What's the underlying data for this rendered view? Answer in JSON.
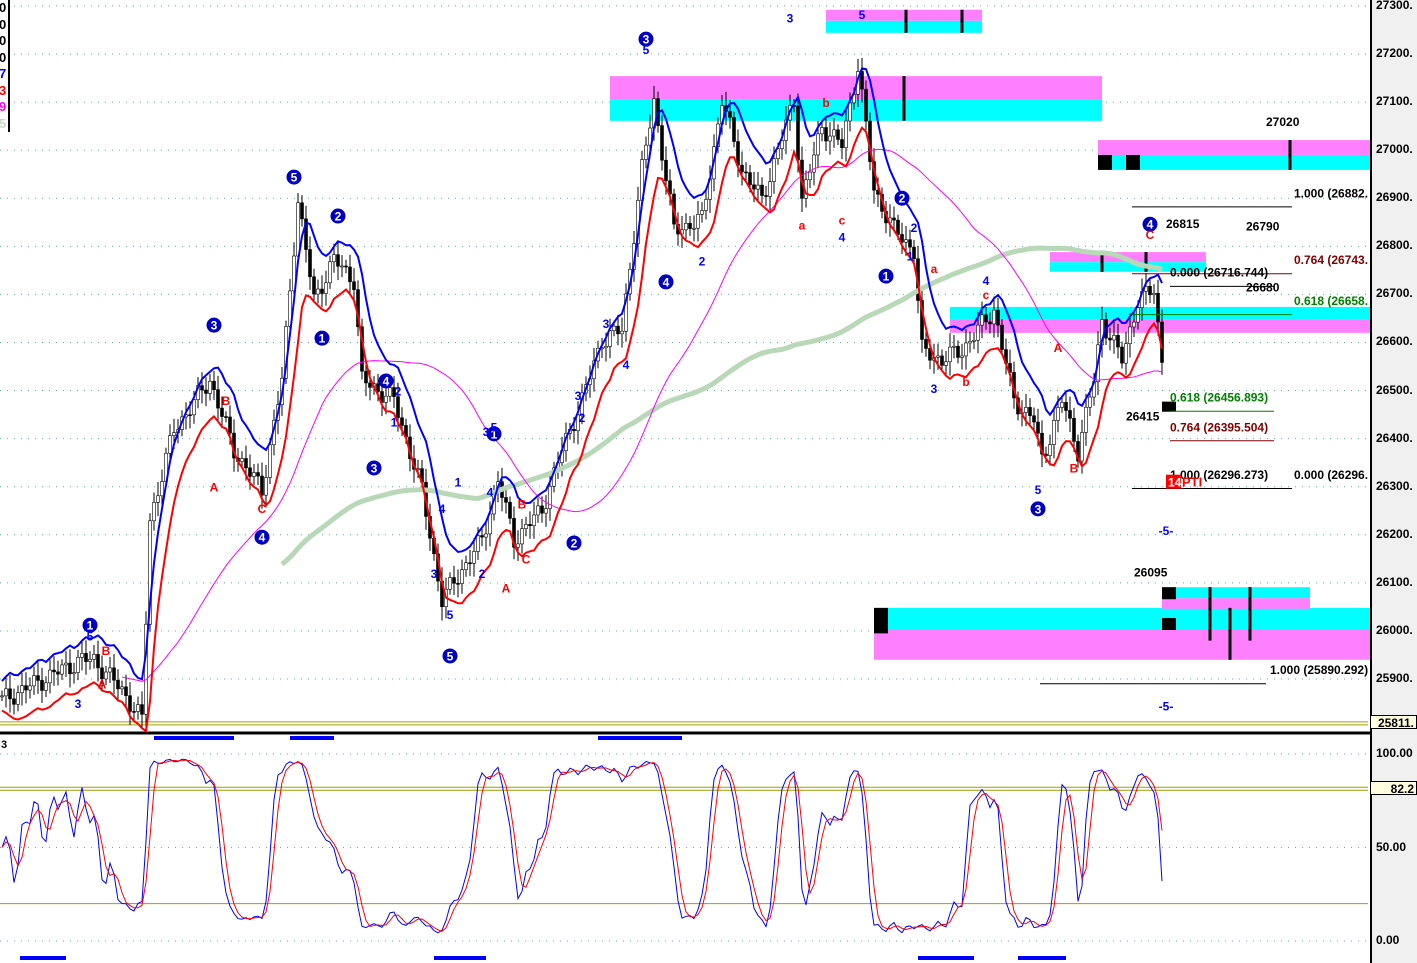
{
  "legend": [
    {
      "t": "0",
      "c": "#000000"
    },
    {
      "t": "0",
      "c": "#000000"
    },
    {
      "t": "0",
      "c": "#000000"
    },
    {
      "t": "0",
      "c": "#000000"
    },
    {
      "t": "7",
      "c": "#0000ff"
    },
    {
      "t": "3",
      "c": "#ff0000"
    },
    {
      "t": "9",
      "c": "#ff00ff"
    },
    {
      "t": "5",
      "c": "#c8dcc8"
    }
  ],
  "stoch_panel_label": "3",
  "chart_data": {
    "type": "candlestick",
    "price_axis": {
      "ticks": [
        "25900.",
        "26000.",
        "26100.",
        "26200.",
        "26300.",
        "26400.",
        "26500.",
        "26600.",
        "26700.",
        "26800.",
        "26900.",
        "27000.",
        "27100.",
        "27200.",
        "27300."
      ],
      "range": [
        25800,
        27310
      ],
      "current": "25811.",
      "current_value": 25811
    },
    "stoch_axis": {
      "ticks": [
        "100.00",
        "50.00",
        "0.00"
      ],
      "current": "82.2",
      "current_value": 82.2,
      "levels": [
        82.2,
        20
      ]
    },
    "close_path": [
      [
        0,
        25856
      ],
      [
        20,
        25940
      ],
      [
        23,
        25940
      ],
      [
        30,
        25877
      ],
      [
        35,
        25815
      ],
      [
        37,
        26231
      ],
      [
        43,
        26418
      ],
      [
        52,
        26522
      ],
      [
        58,
        26376
      ],
      [
        65,
        26293
      ],
      [
        70,
        26522
      ],
      [
        74,
        26896
      ],
      [
        78,
        26688
      ],
      [
        83,
        26772
      ],
      [
        88,
        26730
      ],
      [
        90,
        26522
      ],
      [
        98,
        26480
      ],
      [
        105,
        26293
      ],
      [
        110,
        26064
      ],
      [
        115,
        26127
      ],
      [
        120,
        26189
      ],
      [
        124,
        26314
      ],
      [
        128,
        26189
      ],
      [
        135,
        26252
      ],
      [
        140,
        26376
      ],
      [
        145,
        26480
      ],
      [
        150,
        26605
      ],
      [
        155,
        26626
      ],
      [
        160,
        26959
      ],
      [
        163,
        27104
      ],
      [
        168,
        26834
      ],
      [
        175,
        26855
      ],
      [
        180,
        27104
      ],
      [
        185,
        26959
      ],
      [
        190,
        26896
      ],
      [
        198,
        27104
      ],
      [
        200,
        26896
      ],
      [
        205,
        27050
      ],
      [
        210,
        27010
      ],
      [
        214,
        27177
      ],
      [
        218,
        26917
      ],
      [
        223,
        26834
      ],
      [
        228,
        26792
      ],
      [
        230,
        26584
      ],
      [
        235,
        26564
      ],
      [
        240,
        26584
      ],
      [
        248,
        26668
      ],
      [
        253,
        26480
      ],
      [
        258,
        26439
      ],
      [
        260,
        26356
      ],
      [
        265,
        26480
      ],
      [
        269,
        26376
      ],
      [
        273,
        26522
      ],
      [
        275,
        26647
      ],
      [
        280,
        26564
      ],
      [
        284,
        26688
      ],
      [
        288,
        26709
      ],
      [
        290,
        26564
      ]
    ],
    "colors": {
      "ema_high": "#0000ff",
      "ema_low": "#ff0000",
      "sma_mid": "#ff00ff",
      "sma_long": "#b8d8b8",
      "stoch_k": "#0000ff",
      "stoch_d": "#ff0000",
      "zone_top": "#ff80ff",
      "zone_cyan": "#00ffff"
    },
    "zones": [
      {
        "b0": 206,
        "b1": 245,
        "p": [
          27292,
          27269,
          27244
        ]
      },
      {
        "b0": 152,
        "b1": 275,
        "p": [
          27154,
          27106,
          27061
        ]
      },
      {
        "b0": 274,
        "b1": 342,
        "p": [
          27021,
          26990,
          26959
        ]
      },
      {
        "b0": 262,
        "b1": 301,
        "p": [
          26788,
          26767,
          26747
        ]
      },
      {
        "b0": 237,
        "b1": 342,
        "p": [
          26620,
          26647,
          26674
        ],
        "cyan_top": true
      },
      {
        "b0": 218,
        "b1": 342,
        "p": [
          25940,
          26002,
          26048
        ],
        "cyan_top": true
      },
      {
        "b0": 290,
        "b1": 327,
        "p": [
          26046,
          26068,
          26091
        ],
        "cyan_top": true
      }
    ],
    "blocks": [
      {
        "b0": 274,
        "b1": 277.5,
        "p0": 26990,
        "p1": 26959
      },
      {
        "b0": 281,
        "b1": 284.5,
        "p0": 26990,
        "p1": 26959
      },
      {
        "b0": 218,
        "b1": 221.5,
        "p0": 26048,
        "p1": 25995
      },
      {
        "b0": 290,
        "b1": 293.5,
        "p0": 26091,
        "p1": 26066
      },
      {
        "b0": 290,
        "b1": 293.5,
        "p0": 26027,
        "p1": 26002
      },
      {
        "b0": 290,
        "b1": 293.5,
        "p0": 26477,
        "p1": 26456
      }
    ],
    "ticks_v": [
      {
        "b": 226,
        "p0": 27292,
        "p1": 27244
      },
      {
        "b": 240,
        "p0": 27292,
        "p1": 27244
      },
      {
        "b": 225.5,
        "p0": 27154,
        "p1": 27061
      },
      {
        "b": 322,
        "p0": 27021,
        "p1": 26959
      },
      {
        "b": 275,
        "p0": 26788,
        "p1": 26747
      },
      {
        "b": 286,
        "p0": 26788,
        "p1": 26747
      },
      {
        "b": 302,
        "p0": 26091,
        "p1": 25980
      },
      {
        "b": 312,
        "p0": 26091,
        "p1": 25980
      },
      {
        "b": 307,
        "p0": 26048,
        "p1": 25940
      }
    ],
    "waves": [
      {
        "t": "1",
        "b": 22,
        "p": 26012,
        "circ": true
      },
      {
        "t": "3",
        "b": 53,
        "p": 26636,
        "circ": true
      },
      {
        "t": "5",
        "b": 73,
        "p": 26944,
        "circ": true
      },
      {
        "t": "2",
        "b": 84,
        "p": 26863,
        "circ": true
      },
      {
        "t": "1",
        "b": 80,
        "p": 26609,
        "circ": true
      },
      {
        "t": "4",
        "b": 96,
        "p": 26520,
        "circ": true
      },
      {
        "t": "3",
        "b": 93,
        "p": 26339,
        "circ": true
      },
      {
        "t": "4",
        "b": 65,
        "p": 26195,
        "circ": true
      },
      {
        "t": "5",
        "b": 112,
        "p": 25948,
        "circ": true
      },
      {
        "t": "1",
        "b": 123,
        "p": 26410,
        "circ": true
      },
      {
        "t": "2",
        "b": 143,
        "p": 26183,
        "circ": true
      },
      {
        "t": "3",
        "b": 161,
        "p": 27231,
        "circ": true
      },
      {
        "t": "4",
        "b": 166,
        "p": 26726,
        "circ": true
      },
      {
        "t": "1",
        "b": 221,
        "p": 26738,
        "circ": true
      },
      {
        "t": "2",
        "b": 225,
        "p": 26900,
        "circ": true
      },
      {
        "t": "3",
        "b": 259,
        "p": 26254,
        "circ": true
      },
      {
        "t": "4",
        "b": 287,
        "p": 26846,
        "circ": true
      },
      {
        "t": "5",
        "b": 22,
        "p": 25980,
        "c": "#0000ff"
      },
      {
        "t": "3",
        "b": 19,
        "p": 25840,
        "c": "#0000ff"
      },
      {
        "t": "5",
        "b": 161,
        "p": 27200,
        "c": "#0000ff"
      },
      {
        "t": "3",
        "b": 197,
        "p": 27265,
        "c": "#0000ff"
      },
      {
        "t": "5",
        "b": 215,
        "p": 27273,
        "c": "#0000ff"
      },
      {
        "t": "2",
        "b": 175,
        "p": 26760,
        "c": "#0000ff"
      },
      {
        "t": "3",
        "b": 151,
        "p": 26630,
        "c": "#0000ff"
      },
      {
        "t": "4",
        "b": 156,
        "p": 26545,
        "c": "#0000ff"
      },
      {
        "t": "1",
        "b": 114,
        "p": 26300,
        "c": "#0000ff"
      },
      {
        "t": "4",
        "b": 110,
        "p": 26245,
        "c": "#0000ff"
      },
      {
        "t": "3",
        "b": 108,
        "p": 26110,
        "c": "#0000ff"
      },
      {
        "t": "5",
        "b": 112,
        "p": 26025,
        "c": "#0000ff"
      },
      {
        "t": "2",
        "b": 120,
        "p": 26110,
        "c": "#0000ff"
      },
      {
        "t": "3",
        "b": 121,
        "p": 26405,
        "c": "#0000ff"
      },
      {
        "t": "5",
        "b": 123,
        "p": 26415,
        "c": "#0000ff"
      },
      {
        "t": "4",
        "b": 122,
        "p": 26280,
        "c": "#0000ff"
      },
      {
        "t": "1",
        "b": 98,
        "p": 26425,
        "c": "#0000ff"
      },
      {
        "t": "2",
        "b": 99,
        "p": 26490,
        "c": "#0000ff"
      },
      {
        "t": "2",
        "b": 145,
        "p": 26435,
        "c": "#0000ff"
      },
      {
        "t": "3",
        "b": 144,
        "p": 26480,
        "c": "#0000ff"
      },
      {
        "t": "4",
        "b": 210,
        "p": 26810,
        "c": "#0000ff"
      },
      {
        "t": "2",
        "b": 228,
        "p": 26830,
        "c": "#0000ff"
      },
      {
        "t": "1",
        "b": 227,
        "p": 26770,
        "c": "#0000ff"
      },
      {
        "t": "3",
        "b": 233,
        "p": 26495,
        "c": "#0000ff"
      },
      {
        "t": "4",
        "b": 246,
        "p": 26720,
        "c": "#0000ff"
      },
      {
        "t": "5",
        "b": 259,
        "p": 26285,
        "c": "#0000ff"
      },
      {
        "t": "-5-",
        "b": 291,
        "p": 26200,
        "c": "#0000ff"
      },
      {
        "t": "-5-",
        "b": 291,
        "p": 25835,
        "c": "#0000ff"
      },
      {
        "t": "A",
        "b": 53,
        "p": 26290,
        "c": "#ff0000"
      },
      {
        "t": "B",
        "b": 56,
        "p": 26470,
        "c": "#ff0000"
      },
      {
        "t": "C",
        "b": 65,
        "p": 26245,
        "c": "#ff0000"
      },
      {
        "t": "B",
        "b": 26,
        "p": 25950,
        "c": "#ff0000"
      },
      {
        "t": "A",
        "b": 25,
        "p": 25880,
        "c": "#ff0000"
      },
      {
        "t": "A",
        "b": 126,
        "p": 26080,
        "c": "#ff0000"
      },
      {
        "t": "B",
        "b": 130,
        "p": 26255,
        "c": "#ff0000"
      },
      {
        "t": "C",
        "b": 131,
        "p": 26140,
        "c": "#ff0000"
      },
      {
        "t": "a",
        "b": 200,
        "p": 26835,
        "c": "#ff0000"
      },
      {
        "t": "b",
        "b": 206,
        "p": 27090,
        "c": "#ff0000"
      },
      {
        "t": "c",
        "b": 210,
        "p": 26845,
        "c": "#ff0000"
      },
      {
        "t": "a",
        "b": 233,
        "p": 26745,
        "c": "#ff0000"
      },
      {
        "t": "b",
        "b": 241,
        "p": 26510,
        "c": "#ff0000"
      },
      {
        "t": "c",
        "b": 246,
        "p": 26690,
        "c": "#ff0000"
      },
      {
        "t": "A",
        "b": 264,
        "p": 26580,
        "c": "#ff0000"
      },
      {
        "t": "B",
        "b": 268,
        "p": 26330,
        "c": "#ff0000"
      },
      {
        "t": "C",
        "b": 287,
        "p": 26815,
        "c": "#ff0000"
      }
    ],
    "price_notes": [
      {
        "t": "27020",
        "b": 316,
        "p": 27050
      },
      {
        "t": "26815",
        "b": 291,
        "p": 26838
      },
      {
        "t": "26790",
        "b": 311,
        "p": 26833
      },
      {
        "t": "26680",
        "b": 311,
        "p": 26706
      },
      {
        "t": "26415",
        "b": 281,
        "p": 26438
      },
      {
        "t": "26095",
        "b": 283,
        "p": 26113
      }
    ],
    "fib": [
      {
        "t": "1.000 (26882.",
        "c": "#000000",
        "b": 323,
        "p": 26902,
        "l0": 282.5,
        "l1": 322.5,
        "lp": 26882
      },
      {
        "t": "0.764 (26743.",
        "c": "#800000",
        "b": 323,
        "p": 26763,
        "l0": 282.5,
        "l1": 322.5,
        "lp": 26743
      },
      {
        "t": "0.000 (26716.744)",
        "c": "#000000",
        "b": 292,
        "p": 26737,
        "l0": 292,
        "l1": 318,
        "lp": 26716.7
      },
      {
        "t": "0.618 (26658.",
        "c": "#008000",
        "b": 323,
        "p": 26678,
        "l0": 282.5,
        "l1": 322.5,
        "lp": 26658
      },
      {
        "t": "0.618 (26456.893)",
        "c": "#008000",
        "b": 292,
        "p": 26477,
        "l0": 292,
        "l1": 318,
        "lp": 26456.9
      },
      {
        "t": "0.764 (26395.504)",
        "c": "#800000",
        "b": 292,
        "p": 26415,
        "l0": 292,
        "l1": 318,
        "lp": 26395.5
      },
      {
        "t": "1.000 (26296.273)",
        "c": "#000000",
        "b": 292,
        "p": 26316,
        "l0": 282.5,
        "l1": 322.5,
        "lp": 26296.3
      },
      {
        "t": "0.000 (26296.",
        "c": "#000000",
        "b": 323,
        "p": 26316,
        "l0": 0,
        "l1": 0,
        "lp": 0
      },
      {
        "t": "1.000 (25890.292)",
        "c": "#000000",
        "b": 317,
        "p": 25910,
        "l0": 259.5,
        "l1": 316,
        "lp": 25890.3
      }
    ],
    "pti": {
      "num": "14",
      "txt": "PTI",
      "b": 291.5,
      "p": 26300
    },
    "time_markers_main": [
      [
        38,
        58
      ],
      [
        72,
        83
      ],
      [
        149,
        170
      ]
    ],
    "time_markers_stoch": [
      [
        4.5,
        16
      ],
      [
        108,
        121
      ],
      [
        229,
        243
      ],
      [
        254,
        266
      ]
    ]
  }
}
